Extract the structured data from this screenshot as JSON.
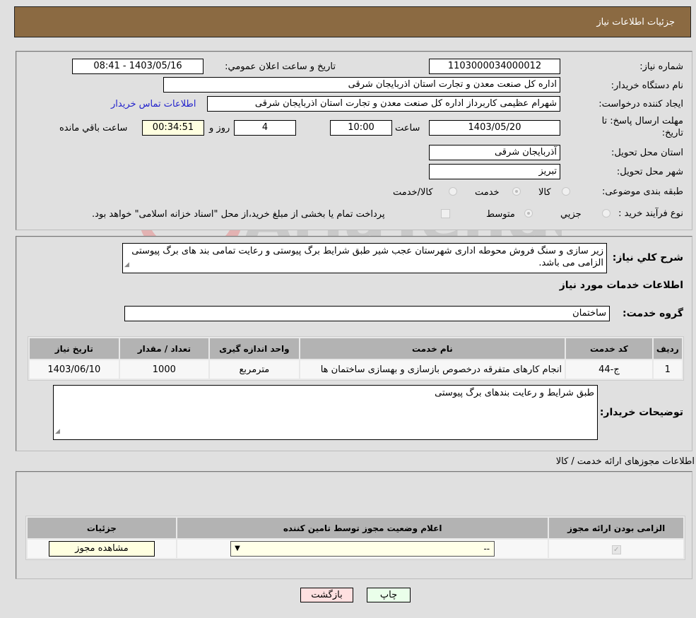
{
  "header": {
    "title": "جزئیات اطلاعات نیاز"
  },
  "details": {
    "need_number_label": "شماره نیاز:",
    "need_number": "1103000034000012",
    "announce_label": "تاریخ و ساعت اعلان عمومي:",
    "announce_value": "1403/05/16 - 08:41",
    "buyer_org_label": "نام دستگاه خریدار:",
    "buyer_org": "اداره کل صنعت  معدن و تجارت استان اذربایجان شرقی",
    "creator_label": "ایجاد کننده درخواست:",
    "creator": "شهرام عظیمی کاربرداز اداره کل صنعت  معدن و تجارت استان اذربایجان شرقی",
    "contact_link": "اطلاعات تماس خریدار",
    "deadline_label_line1": "مهلت ارسال پاسخ: تا",
    "deadline_label_line2": "تاریخ:",
    "deadline_date": "1403/05/20",
    "time_label": "ساعت",
    "deadline_time": "10:00",
    "days_value": "4",
    "days_label": "روز و",
    "remaining_time": "00:34:51",
    "remaining_label": "ساعت باقي مانده",
    "province_label": "استان محل تحویل:",
    "province": "آذربایجان شرقی",
    "city_label": "شهر محل تحویل:",
    "city": "تبریز",
    "category_label": "طبقه بندی موضوعی:",
    "category_options": [
      "کالا",
      "خدمت",
      "کالا/خدمت"
    ],
    "category_selected": "خدمت",
    "process_label": "نوع فرآیند خرید :",
    "process_options": [
      "جزيي",
      "متوسط"
    ],
    "process_selected": "متوسط",
    "treasury_note": "پرداخت تمام یا بخشی از مبلغ خرید،از محل \"اسناد خزانه اسلامی\" خواهد بود."
  },
  "description": {
    "label": "شرح کلي نیاز:",
    "text": "زیر سازی و سنگ فروش محوطه اداری شهرستان عجب شیر طبق شرایط برگ پیوستی و رعایت تمامی بند های برگ پیوستی الزامی می باشد."
  },
  "services": {
    "section_title": "اطلاعات خدمات مورد نیاز",
    "group_label": "گروه خدمت:",
    "group_value": "ساختمان",
    "columns": [
      "ردیف",
      "کد خدمت",
      "نام خدمت",
      "واحد اندازه گیری",
      "تعداد / مقدار",
      "تاریخ نیاز"
    ],
    "rows": [
      {
        "index": "1",
        "code": "ج-44",
        "name": "انجام کارهای متفرقه درخصوص بازسازی و بهسازی ساختمان ها",
        "unit": "مترمربع",
        "quantity": "1000",
        "date": "1403/06/10"
      }
    ],
    "buyer_notes_label": "توضیحات خریدار:",
    "buyer_notes": "طبق شرایط و رعایت بندهای برگ پیوستی"
  },
  "permits": {
    "section_title": "اطلاعات مجوزهای ارائه خدمت / کالا",
    "columns": [
      "الزامی بودن ارائه مجوز",
      "اعلام وضعیت مجوز توسط تامین کننده",
      "جزئیات"
    ],
    "rows": [
      {
        "required": true,
        "status_selected": "--",
        "details_button": "مشاهده مجوز"
      }
    ]
  },
  "footer": {
    "print_button": "چاپ",
    "back_button": "بازگشت"
  },
  "watermark": {
    "text": "AriaTender.neT"
  }
}
